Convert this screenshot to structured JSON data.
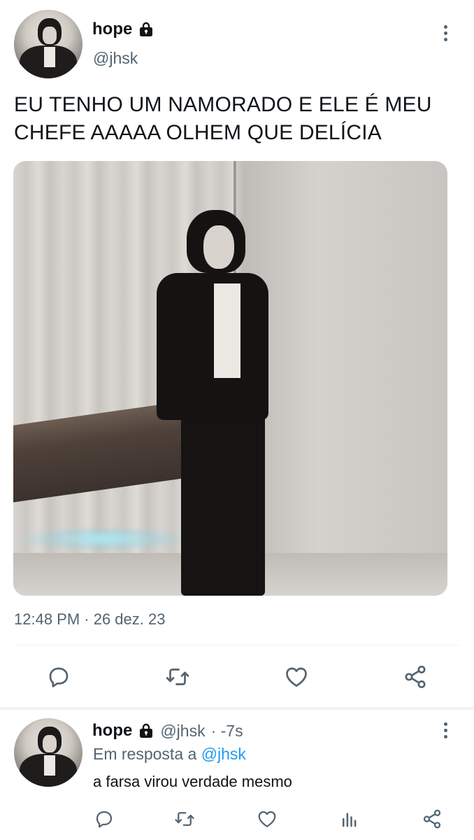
{
  "main_tweet": {
    "author_name": "hope",
    "author_handle": "@jhsk",
    "text": "EU TENHO UM NAMORADO E ELE É MEU CHEFE AAAAA OLHEM QUE DELÍCIA",
    "timestamp": "12:48 PM · 26 dez. 23",
    "icons": {
      "protected": "lock-icon",
      "more": "more-vertical-icon",
      "reply": "reply-icon",
      "retweet": "retweet-icon",
      "like": "heart-icon",
      "share": "share-icon"
    }
  },
  "reply_tweet": {
    "author_name": "hope",
    "author_handle": "@jhsk",
    "time_ago": "· -7s",
    "in_reply_prefix": "Em resposta a",
    "in_reply_mention": "@jhsk",
    "text": "a farsa virou verdade mesmo",
    "icons": {
      "reply": "reply-icon",
      "retweet": "retweet-icon",
      "like": "heart-icon",
      "views": "views-icon",
      "share": "share-icon"
    }
  },
  "colors": {
    "text_primary": "#0f1419",
    "text_secondary": "#536471",
    "link": "#1d9bf0",
    "divider": "#eff3f4"
  }
}
